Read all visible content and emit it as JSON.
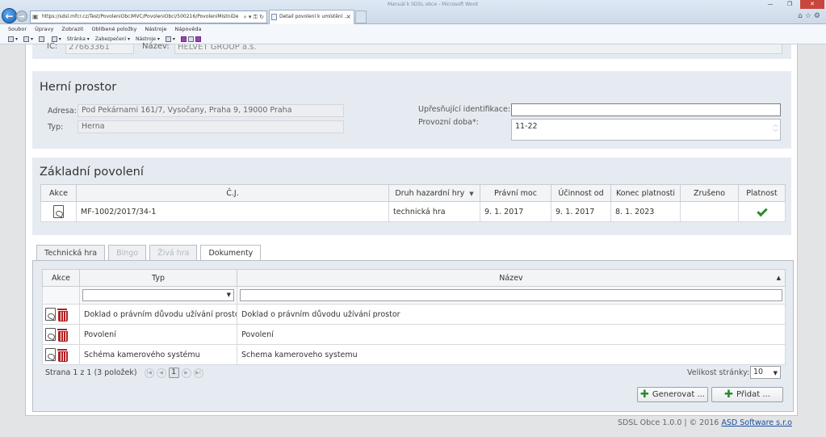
{
  "browser": {
    "url": "https://sdsl.mfcr.cz/Test/PovoleniObciMVC/PovoleniObci/500216/PovoleniMistniDe",
    "tab_title": "Detail povolení k umístění ...",
    "window_title": "Manuál k SDSL obce - Microsoft Word",
    "menu": [
      "Soubor",
      "Úpravy",
      "Zobrazit",
      "Oblíbené položky",
      "Nástroje",
      "Nápověda"
    ],
    "commands": [
      "Stránka ▾",
      "Zabezpečení ▾",
      "Nástroje ▾"
    ]
  },
  "top_section": {
    "ic_label": "IČ:",
    "ic_value": "27663361",
    "name_label": "Název:",
    "name_value": "HELVET GROUP a.s."
  },
  "game_space": {
    "title": "Herní prostor",
    "address_label": "Adresa:",
    "address_value": "Pod Pekárnami 161/7, Vysočany, Praha 9, 19000 Praha",
    "type_label": "Typ:",
    "type_value": "Herna",
    "identification_label": "Upřesňující identifikace:",
    "identification_value": "",
    "hours_label": "Provozní doba*:",
    "hours_value": "11-22"
  },
  "basic_permit": {
    "title": "Základní povolení",
    "columns": [
      "Akce",
      "Č.J.",
      "Druh hazardní hry",
      "Právní moc",
      "Účinnost od",
      "Konec platnosti",
      "Zrušeno",
      "Platnost"
    ],
    "rows": [
      {
        "cj": "MF-1002/2017/34-1",
        "game_type": "technická hra",
        "legal_force": "9. 1. 2017",
        "effective_from": "9. 1. 2017",
        "valid_until": "8. 1. 2023",
        "cancelled": ""
      }
    ]
  },
  "tabs": [
    "Technická hra",
    "Bingo",
    "Živá hra",
    "Dokumenty"
  ],
  "documents": {
    "columns": [
      "Akce",
      "Typ",
      "Název"
    ],
    "filter_type_value": "",
    "filter_name_value": "",
    "rows": [
      {
        "type": "Doklad o právním důvodu užívání prostor",
        "name": "Doklad o právním důvodu užívání prostor"
      },
      {
        "type": "Povolení",
        "name": "Povolení"
      },
      {
        "type": "Schéma kamerového systému",
        "name": "Schema kameroveho systemu"
      }
    ],
    "pager_text": "Strana 1 z 1 (3 položek)",
    "current_page": "1",
    "page_size_label": "Velikost stránky:",
    "page_size_value": "10",
    "generate_label": "Generovat ...",
    "add_label": "Přidat ..."
  },
  "footer": {
    "version": "SDSL Obce 1.0.0  |  © 2016",
    "company": "ASD Software s.r.o"
  }
}
